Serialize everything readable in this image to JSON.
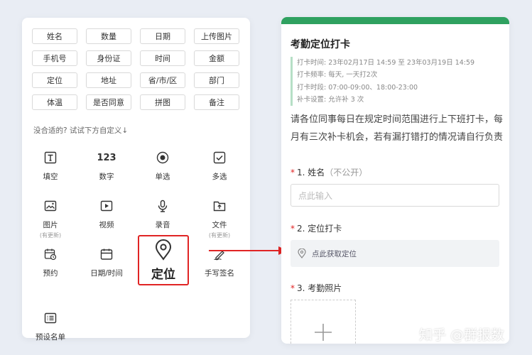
{
  "fields": {
    "chips": [
      "姓名",
      "数量",
      "日期",
      "上传图片",
      "手机号",
      "身份证",
      "时间",
      "金额",
      "定位",
      "地址",
      "省/市/区",
      "部门",
      "体温",
      "是否同意",
      "拼图",
      "备注"
    ],
    "hint": "没合适的? 试试下方自定义↓",
    "custom": {
      "fill_blank": "填空",
      "number": "数字",
      "number_icon": "123",
      "single_choice": "单选",
      "multi_choice": "多选",
      "image": "图片",
      "image_sub": "(有更新)",
      "video": "视频",
      "audio": "录音",
      "file": "文件",
      "file_sub": "(有更新)",
      "appointment": "预约",
      "datetime": "日期/时间",
      "location": "定位",
      "signature": "手写签名",
      "preset_list": "预设名单"
    }
  },
  "form": {
    "title": "考勤定位打卡",
    "meta": [
      "打卡时间: 23年02月17日 14:59 至 23年03月19日 14:59",
      "打卡频率: 每天, 一天打2次",
      "打卡时段: 07:00-09:00、18:00-23:00",
      "补卡设置: 允许补 3 次"
    ],
    "description": "请各位同事每日在规定时间范围进行上下班打卡，每月有三次补卡机会，若有漏打错打的情况请自行负责",
    "q1": {
      "label": "1. 姓名",
      "note": "（不公开）",
      "placeholder": "点此输入"
    },
    "q2": {
      "label": "2. 定位打卡",
      "action": "点此获取定位"
    },
    "q3": {
      "label": "3. 考勤照片"
    },
    "required_mark": "*"
  },
  "watermark": "知乎 @群报数",
  "colors": {
    "accent_green": "#2fa160",
    "highlight_red": "#e02424"
  }
}
